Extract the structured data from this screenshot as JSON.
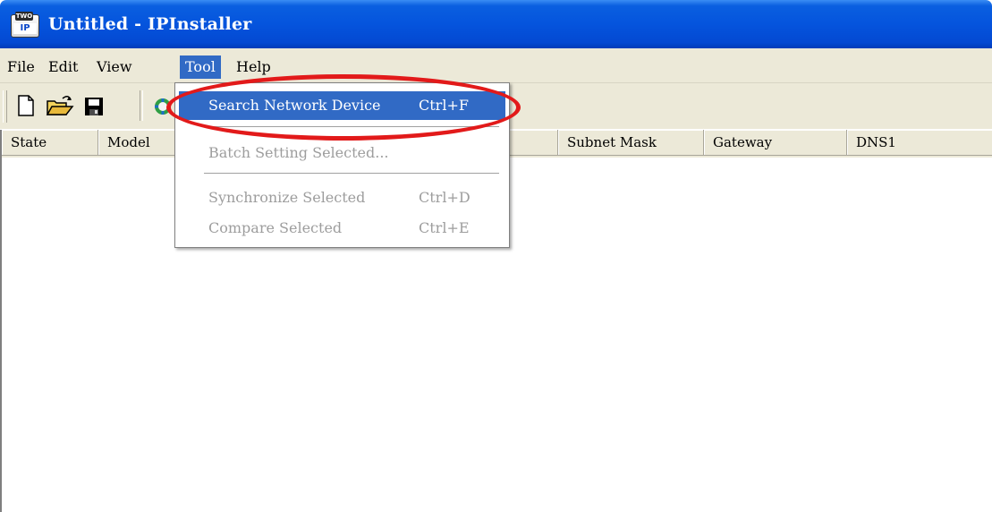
{
  "window": {
    "title": "Untitled - IPInstaller",
    "icon_label": "IP",
    "icon_cap": "TWO"
  },
  "menubar": {
    "file": "File",
    "edit": "Edit",
    "view": "View",
    "tool": "Tool",
    "help": "Help"
  },
  "toolbar": {
    "buttons": [
      "new-file-icon",
      "open-folder-icon",
      "save-icon",
      "search-network-icon"
    ]
  },
  "list": {
    "columns": [
      "State",
      "Model",
      "",
      "Subnet Mask",
      "Gateway",
      "DNS1"
    ]
  },
  "tool_menu": {
    "search_network_device": "Search Network Device",
    "search_shortcut": "Ctrl+F",
    "batch_setting_selected": "Batch Setting Selected...",
    "synchronize_selected": "Synchronize Selected",
    "synchronize_shortcut": "Ctrl+D",
    "compare_selected": "Compare Selected",
    "compare_shortcut": "Ctrl+E"
  },
  "colors": {
    "title_bar": "#0554dd",
    "menu_highlight": "#316ac5",
    "annotation": "#e21a1a",
    "disabled_text": "#9d9d9d"
  }
}
